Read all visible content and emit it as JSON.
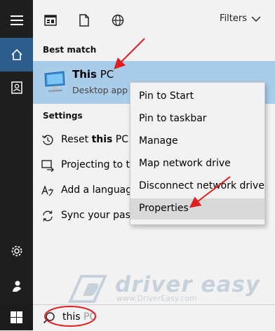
{
  "toolbar": {
    "icons": [
      "apps-icon",
      "document-icon",
      "web-icon"
    ],
    "filters_label": "Filters"
  },
  "rail": {
    "items": [
      "hamburger-icon",
      "home-icon",
      "contacts-icon",
      "settings-icon",
      "user-icon",
      "windows-icon"
    ]
  },
  "results": {
    "best_match_header": "Best match",
    "best_match": {
      "title_bold": "This",
      "title_rest": " PC",
      "subtitle": "Desktop app",
      "icon": "monitor-icon"
    },
    "settings_header": "Settings",
    "settings_items": [
      {
        "pre": "Reset ",
        "bold": "this",
        "post": " PC",
        "icon": "reset-icon"
      },
      {
        "pre": "Projecting to t",
        "bold": "",
        "post": "",
        "icon": "project-icon"
      },
      {
        "pre": "Add a languag",
        "bold": "",
        "post": "",
        "icon": "language-icon"
      },
      {
        "pre": "Sync your pass",
        "bold": "",
        "post": "",
        "icon": "sync-icon"
      }
    ]
  },
  "context_menu": {
    "items": [
      "Pin to Start",
      "Pin to taskbar",
      "Manage",
      "Map network drive",
      "Disconnect network drive",
      "Properties"
    ],
    "highlighted": "Properties"
  },
  "search": {
    "typed": "this",
    "ghost": " PC"
  },
  "watermark": {
    "name": "driver easy",
    "url": "www.DriverEasy.com"
  },
  "colors": {
    "selection": "#a9cde9",
    "rail": "#1f1f1f",
    "rail_active": "#2d5d8a",
    "annotation": "#e02020"
  }
}
